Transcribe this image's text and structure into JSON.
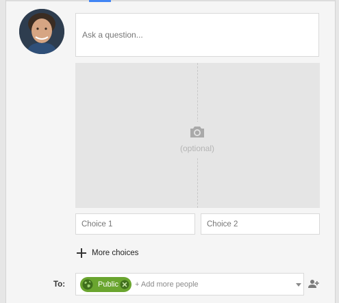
{
  "composer": {
    "question_placeholder": "Ask a question...",
    "photo_hint": "(optional)",
    "choice1_placeholder": "Choice 1",
    "choice2_placeholder": "Choice 2",
    "more_choices_label": "More choices"
  },
  "share": {
    "to_label": "To:",
    "chip_label": "Public",
    "add_people_placeholder": "+ Add more people"
  },
  "icons": {
    "avatar": "user-avatar",
    "camera": "camera-icon",
    "plus": "plus-icon",
    "globe": "globe-icon",
    "remove": "close-circle-icon",
    "dropdown": "chevron-down-icon",
    "add_person": "add-person-icon"
  },
  "colors": {
    "accent_tab": "#4285f4",
    "chip_green": "#6aa52f"
  }
}
